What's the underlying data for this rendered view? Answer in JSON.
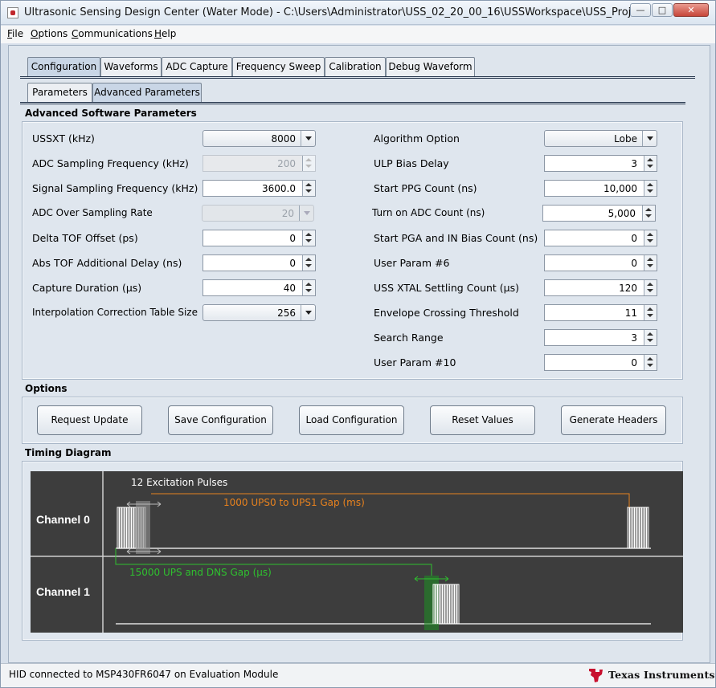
{
  "window": {
    "title": "Ultrasonic Sensing Design Center (Water Mode) - C:\\Users\\Administrator\\USS_02_20_00_16\\USSWorkspace\\USS_Project",
    "minimize": "—",
    "maximize": "□",
    "close": "✕"
  },
  "menu": [
    "File",
    "Options",
    "Communications",
    "Help"
  ],
  "tabs": [
    "Configuration",
    "Waveforms",
    "ADC Capture",
    "Frequency Sweep",
    "Calibration",
    "Debug Waveform"
  ],
  "subtabs": [
    "Parameters",
    "Advanced Parameters"
  ],
  "advanced": {
    "title": "Advanced Software Parameters",
    "left": [
      {
        "label": "USSXT (kHz)",
        "value": "8000",
        "kind": "combo"
      },
      {
        "label": "ADC Sampling Frequency (kHz)",
        "value": "200",
        "kind": "spin-disabled"
      },
      {
        "label": "Signal Sampling Frequency (kHz)",
        "value": "3600.0",
        "kind": "spin"
      },
      {
        "label": "ADC Over Sampling Rate",
        "value": "20",
        "kind": "combo-disabled"
      },
      {
        "label": "Delta TOF Offset (ps)",
        "value": "0",
        "kind": "spin"
      },
      {
        "label": "Abs TOF Additional Delay (ns)",
        "value": "0",
        "kind": "spin"
      },
      {
        "label": "Capture Duration (µs)",
        "value": "40",
        "kind": "spin"
      },
      {
        "label": "Interpolation Correction Table Size",
        "value": "256",
        "kind": "combo"
      }
    ],
    "right": [
      {
        "label": "Algorithm Option",
        "value": "Lobe",
        "kind": "combo"
      },
      {
        "label": "ULP Bias Delay",
        "value": "3",
        "kind": "spin"
      },
      {
        "label": "Start PPG Count (ns)",
        "value": "10,000",
        "kind": "spin"
      },
      {
        "label": "Turn on ADC Count (ns)",
        "value": "5,000",
        "kind": "spin"
      },
      {
        "label": "Start PGA and IN Bias Count (ns)",
        "value": "0",
        "kind": "spin"
      },
      {
        "label": "User Param #6",
        "value": "0",
        "kind": "spin"
      },
      {
        "label": "USS XTAL Settling Count (µs)",
        "value": "120",
        "kind": "spin"
      },
      {
        "label": "Envelope Crossing Threshold",
        "value": "11",
        "kind": "spin"
      },
      {
        "label": "Search Range",
        "value": "3",
        "kind": "spin"
      },
      {
        "label": "User Param #10",
        "value": "0",
        "kind": "spin"
      }
    ]
  },
  "options": {
    "title": "Options",
    "buttons": [
      "Request Update",
      "Save Configuration",
      "Load Configuration",
      "Reset Values",
      "Generate Headers"
    ]
  },
  "timing": {
    "title": "Timing Diagram",
    "channel0": "Channel 0",
    "channel1": "Channel 1",
    "excitation": "12 Excitation Pulses",
    "ups_gap": "1000 UPS0 to UPS1 Gap (ms)",
    "dns_gap": "15000 UPS and DNS Gap (µs)",
    "colors": {
      "bg": "#3d3d3d",
      "wave": "#ffffff",
      "ups": "#e8821e",
      "dns": "#2fc02f"
    }
  },
  "status": {
    "text": "HID connected to MSP430FR6047 on Evaluation Module",
    "logo": "Texas Instruments"
  }
}
